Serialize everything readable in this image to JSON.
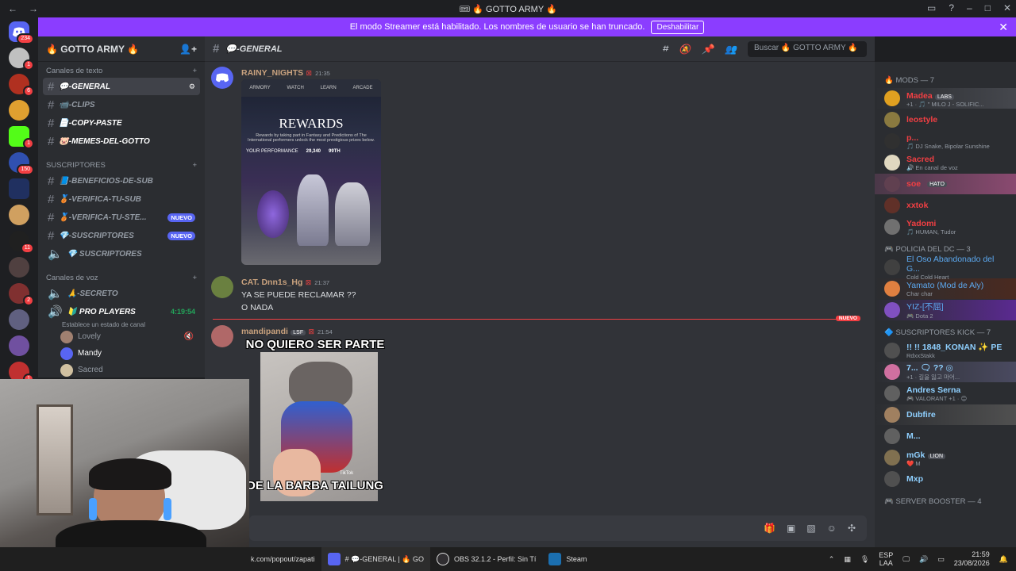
{
  "window": {
    "title": "🎟 🔥 GOTTO ARMY 🔥"
  },
  "banner": {
    "text": "El modo Streamer está habilitado. Los nombres de usuario se han truncado.",
    "button": "Deshabilitar"
  },
  "servers": {
    "home_badge": "234",
    "badges": [
      "1",
      "6",
      "",
      "1",
      "150",
      "",
      "",
      "11",
      "",
      "2",
      "",
      "",
      "1"
    ]
  },
  "guild": {
    "name": "🔥 GOTTO ARMY 🔥"
  },
  "channels": {
    "text_category": "Canales de texto",
    "text": [
      {
        "name": "💬-GENERAL",
        "active": true
      },
      {
        "name": "📹-CLIPS"
      },
      {
        "name": "📄-COPY-PASTE"
      },
      {
        "name": "🐷-MEMES-DEL-GOTTO"
      }
    ],
    "subs_category": "SUSCRIPTORES",
    "subs": [
      {
        "name": "📘-BENEFICIOS-DE-SUB"
      },
      {
        "name": "🥉-VERIFICA-TU-SUB"
      },
      {
        "name": "🥉-VERIFICA-TU-STE...",
        "badge": "NUEVO"
      },
      {
        "name": "💎-SUSCRIPTORES",
        "badge": "NUEVO"
      },
      {
        "name": "💎 SUSCRIPTORES"
      }
    ],
    "voice_category": "Canales de voz",
    "voice": [
      {
        "name": "🙏-SECRETO"
      },
      {
        "name": "🔰 PRO PLAYERS",
        "time": "4:19:54"
      }
    ],
    "voice_status": "Establece un estado de canal",
    "voice_users": [
      "Lovely",
      "Mandy",
      "Sacred"
    ]
  },
  "chat": {
    "channel": "💬-GENERAL",
    "search_placeholder": "Buscar 🔥 GOTTO ARMY 🔥",
    "new_label": "NUEVO",
    "messages": [
      {
        "user": "RAINY_NIGHTS",
        "time": "21:35",
        "image": {
          "tabs": [
            "ARMORY",
            "WATCH",
            "LEARN",
            "ARCADE"
          ],
          "title": "REWARDS",
          "sub": "Rewards by taking part in Fantasy and Predictions of The International performers unlock the most prestigious prizes below.",
          "perf": "YOUR PERFORMANCE",
          "pts": "29,340",
          "rank": "99TH"
        }
      },
      {
        "user": "CAT. Dnn1s_Hg",
        "time": "21:37",
        "lines": [
          "YA SE PUEDE RECLAMAR ??",
          "O NADA"
        ]
      },
      {
        "user": "mandipandi",
        "tag": "LSF",
        "time": "21:54",
        "meme_top": "NO QUIERO SER PARTE",
        "meme_bottom": "DE LA BARBA TAILUNG",
        "watermark": "TikTok"
      }
    ]
  },
  "members": {
    "groups": [
      {
        "title": "🔥 MODS — 7",
        "items": [
          {
            "name": "Madea",
            "tag": "LABS",
            "status": "+1 · 🎵 \" MILO J - SOLIFIC...",
            "color": "#f23f43"
          },
          {
            "name": "leostyle",
            "status": "",
            "color": "#f23f43"
          },
          {
            "name": "p...",
            "status": "🎵 DJ Snake, Bipolar Sunshine",
            "color": "#f23f43"
          },
          {
            "name": "Sacred",
            "status": "🔊 En canal de voz",
            "color": "#f23f43"
          },
          {
            "name": "soe",
            "tag": "HATO",
            "status": "",
            "color": "#f23f43"
          },
          {
            "name": "xxtok",
            "status": "",
            "color": "#f23f43"
          },
          {
            "name": "Yadomi",
            "status": "🎵 HUMAN, Tudor",
            "color": "#f23f43"
          }
        ]
      },
      {
        "title": "🎮 POLICIA DEL DC — 3",
        "items": [
          {
            "name": "El Oso Abandonado del G...",
            "status": "Cold Cold Heart",
            "color": "#5ca9f0"
          },
          {
            "name": "Yamato (Mod de Aly)",
            "status": "Char char",
            "color": "#5ca9f0"
          },
          {
            "name": "YIZ-[不屈]",
            "status": "🎮 Dota 2",
            "color": "#5ca9f0"
          }
        ]
      },
      {
        "title": "🔷 SUSCRIPTORES KICK — 7",
        "items": [
          {
            "name": "!! !! 1848_KONAN ✨ PE",
            "status": "RdxxStakk",
            "color": "#8fd0ff"
          },
          {
            "name": "7... 🗨 ?? ◎",
            "status": "+1 · 길을 잃고 마어...",
            "color": "#8fd0ff"
          },
          {
            "name": "Andres Serna",
            "status": "🎮 VALORANT +1 · 😊",
            "color": "#8fd0ff"
          },
          {
            "name": "Dubfire",
            "status": "",
            "color": "#8fd0ff"
          },
          {
            "name": "M...",
            "status": "",
            "color": "#8fd0ff"
          },
          {
            "name": "mGk",
            "tag": "LION",
            "status": "❤️ M",
            "color": "#8fd0ff"
          },
          {
            "name": "Mxp",
            "status": "",
            "color": "#8fd0ff"
          }
        ]
      },
      {
        "title": "🎮 SERVER BOOSTER — 4",
        "items": []
      }
    ]
  },
  "taskbar": {
    "items": [
      {
        "label": "k.com/popout/zapati"
      },
      {
        "label": "# 💬-GENERAL | 🔥 GO"
      },
      {
        "label": "OBS 32.1.2 - Perfil: Sin Tí"
      },
      {
        "label": "Steam"
      }
    ],
    "lang": "ESP",
    "lang_sub": "LAA",
    "time": "21:59",
    "date": "23/08/2026"
  }
}
